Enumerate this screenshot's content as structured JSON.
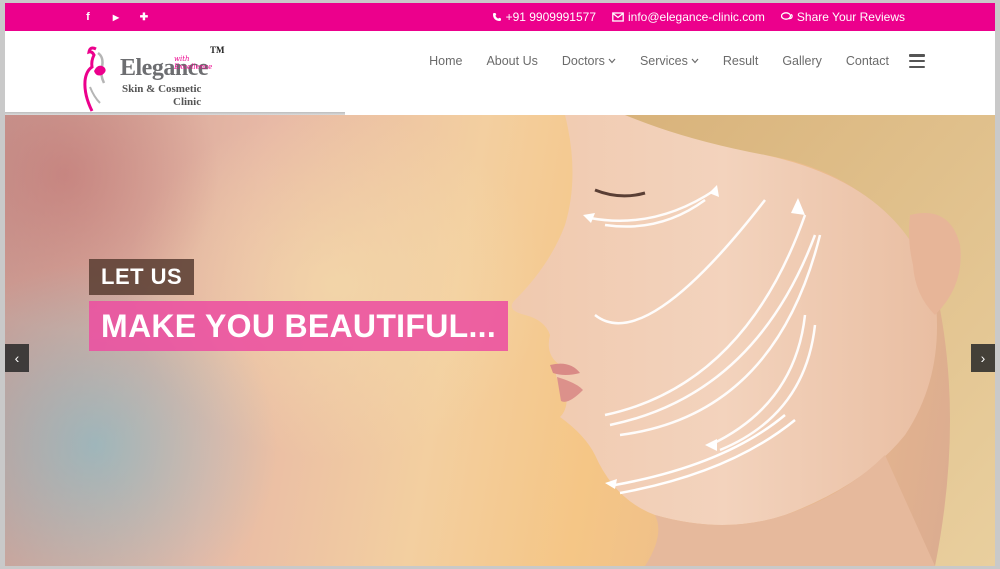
{
  "topbar": {
    "social": {
      "facebook": "f",
      "youtube": "▶",
      "googleplus": "✚"
    },
    "phone": "+91 9909991577",
    "email": "info@elegance-clinic.com",
    "reviews": "Share Your Reviews"
  },
  "logo": {
    "brand": "Elegance",
    "tagline": "with Excellence",
    "tm": "TM",
    "line1": "Skin & Cosmetic",
    "line2": "Clinic"
  },
  "nav": {
    "items": [
      {
        "label": "Home"
      },
      {
        "label": "About Us"
      },
      {
        "label": "Doctors"
      },
      {
        "label": "Services"
      },
      {
        "label": "Result"
      },
      {
        "label": "Gallery"
      },
      {
        "label": "Contact"
      }
    ]
  },
  "hero": {
    "caption_small": "LET US",
    "caption_large": "MAKE YOU BEAUTIFUL...",
    "prev": "‹",
    "next": "›"
  },
  "colors": {
    "brand": "#ec008c",
    "caption_pink": "#ec50a0",
    "caption_brown": "#5c4034"
  }
}
